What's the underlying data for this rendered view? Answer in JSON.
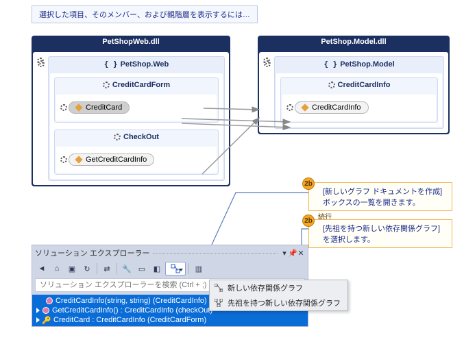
{
  "hint": "選択した項目、そのメンバー、および親階層を表示するには…",
  "left_dll": {
    "title": "PetShopWeb.dll",
    "namespace": "PetShop.Web",
    "classes": [
      {
        "name": "CreditCardForm",
        "member": "CreditCard",
        "selected": true
      },
      {
        "name": "CheckOut",
        "member": "GetCreditCardInfo",
        "selected": false
      }
    ]
  },
  "right_dll": {
    "title": "PetShop.Model.dll",
    "namespace": "PetShop.Model",
    "classes": [
      {
        "name": "CreditCardInfo",
        "member": "CreditCardInfo",
        "selected": false
      }
    ]
  },
  "callouts": [
    {
      "id": "2b",
      "text": "[新しいグラフ ドキュメントを作成] ボックスの一覧を開きます。"
    },
    {
      "id": "2b",
      "cont": "続行",
      "text": "[先祖を持つ新しい依存関係グラフ] を選択します。"
    }
  ],
  "solution_explorer": {
    "title": "ソリューション エクスプローラー",
    "search_placeholder": "ソリューション エクスプローラーを検索 (Ctrl + ;)",
    "tree": [
      "CreditCardInfo(string, string) (CreditCardInfo)",
      "GetCreditCardInfo() : CreditCardInfo (checkOut)",
      "CreditCard : CreditCardInfo (CreditCardForm)"
    ]
  },
  "dropdown": {
    "items": [
      "新しい依存関係グラフ",
      "先祖を持つ新しい依存関係グラフ"
    ]
  }
}
